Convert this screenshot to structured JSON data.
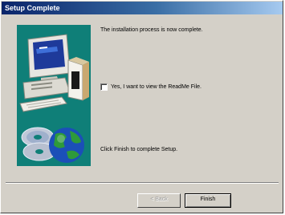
{
  "window": {
    "title": "Setup Complete"
  },
  "banner": {
    "icons": [
      "computer-icon",
      "cd-disc-icon",
      "globe-icon"
    ],
    "background_color": "#0f7f78"
  },
  "content": {
    "status_message": "The installation process is now complete.",
    "readme_checkbox": {
      "label": "Yes, I want to view the ReadMe File.",
      "checked": false
    },
    "finish_instruction": "Click Finish to complete Setup."
  },
  "buttons": {
    "back_label": "< Back",
    "back_enabled": false,
    "finish_label": "Finish"
  },
  "colors": {
    "titlebar_start": "#0a246a",
    "dialog_face": "#d4d0c8"
  }
}
